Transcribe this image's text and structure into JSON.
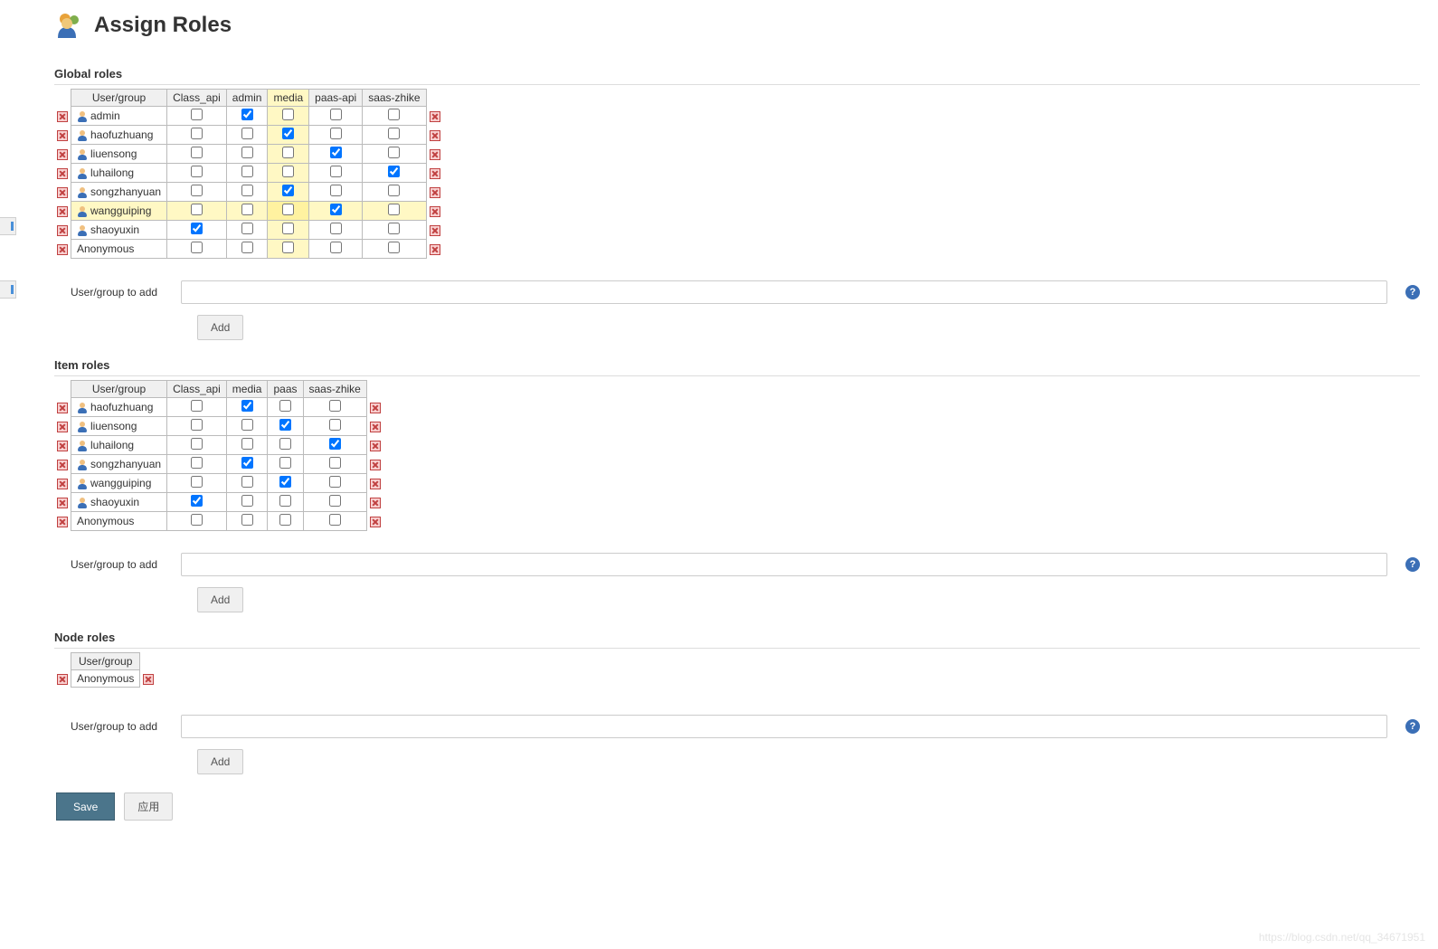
{
  "page_title": "Assign Roles",
  "watermark": "https://blog.csdn.net/qq_34671951",
  "sections": {
    "global": {
      "heading": "Global roles",
      "user_header": "User/group",
      "columns": [
        "Class_api",
        "admin",
        "media",
        "paas-api",
        "saas-zhike"
      ],
      "highlight_col_index": 2,
      "highlight_row_index": 5,
      "rows": [
        {
          "user": "admin",
          "has_icon": true,
          "checks": [
            false,
            true,
            false,
            false,
            false
          ]
        },
        {
          "user": "haofuzhuang",
          "has_icon": true,
          "checks": [
            false,
            false,
            true,
            false,
            false
          ]
        },
        {
          "user": "liuensong",
          "has_icon": true,
          "checks": [
            false,
            false,
            false,
            true,
            false
          ]
        },
        {
          "user": "luhailong",
          "has_icon": true,
          "checks": [
            false,
            false,
            false,
            false,
            true
          ]
        },
        {
          "user": "songzhanyuan",
          "has_icon": true,
          "checks": [
            false,
            false,
            true,
            false,
            false
          ]
        },
        {
          "user": "wangguiping",
          "has_icon": true,
          "checks": [
            false,
            false,
            false,
            true,
            false
          ]
        },
        {
          "user": "shaoyuxin",
          "has_icon": true,
          "checks": [
            true,
            false,
            false,
            false,
            false
          ]
        },
        {
          "user": "Anonymous",
          "has_icon": false,
          "checks": [
            false,
            false,
            false,
            false,
            false
          ]
        }
      ],
      "add_label": "User/group to add",
      "add_button": "Add"
    },
    "item": {
      "heading": "Item roles",
      "user_header": "User/group",
      "columns": [
        "Class_api",
        "media",
        "paas",
        "saas-zhike"
      ],
      "rows": [
        {
          "user": "haofuzhuang",
          "has_icon": true,
          "checks": [
            false,
            true,
            false,
            false
          ]
        },
        {
          "user": "liuensong",
          "has_icon": true,
          "checks": [
            false,
            false,
            true,
            false
          ]
        },
        {
          "user": "luhailong",
          "has_icon": true,
          "checks": [
            false,
            false,
            false,
            true
          ]
        },
        {
          "user": "songzhanyuan",
          "has_icon": true,
          "checks": [
            false,
            true,
            false,
            false
          ]
        },
        {
          "user": "wangguiping",
          "has_icon": true,
          "checks": [
            false,
            false,
            true,
            false
          ]
        },
        {
          "user": "shaoyuxin",
          "has_icon": true,
          "checks": [
            true,
            false,
            false,
            false
          ]
        },
        {
          "user": "Anonymous",
          "has_icon": false,
          "checks": [
            false,
            false,
            false,
            false
          ]
        }
      ],
      "add_label": "User/group to add",
      "add_button": "Add"
    },
    "node": {
      "heading": "Node roles",
      "user_header": "User/group",
      "columns": [],
      "rows": [
        {
          "user": "Anonymous",
          "has_icon": false,
          "checks": []
        }
      ],
      "add_label": "User/group to add",
      "add_button": "Add"
    }
  },
  "footer": {
    "save": "Save",
    "apply": "应用"
  }
}
